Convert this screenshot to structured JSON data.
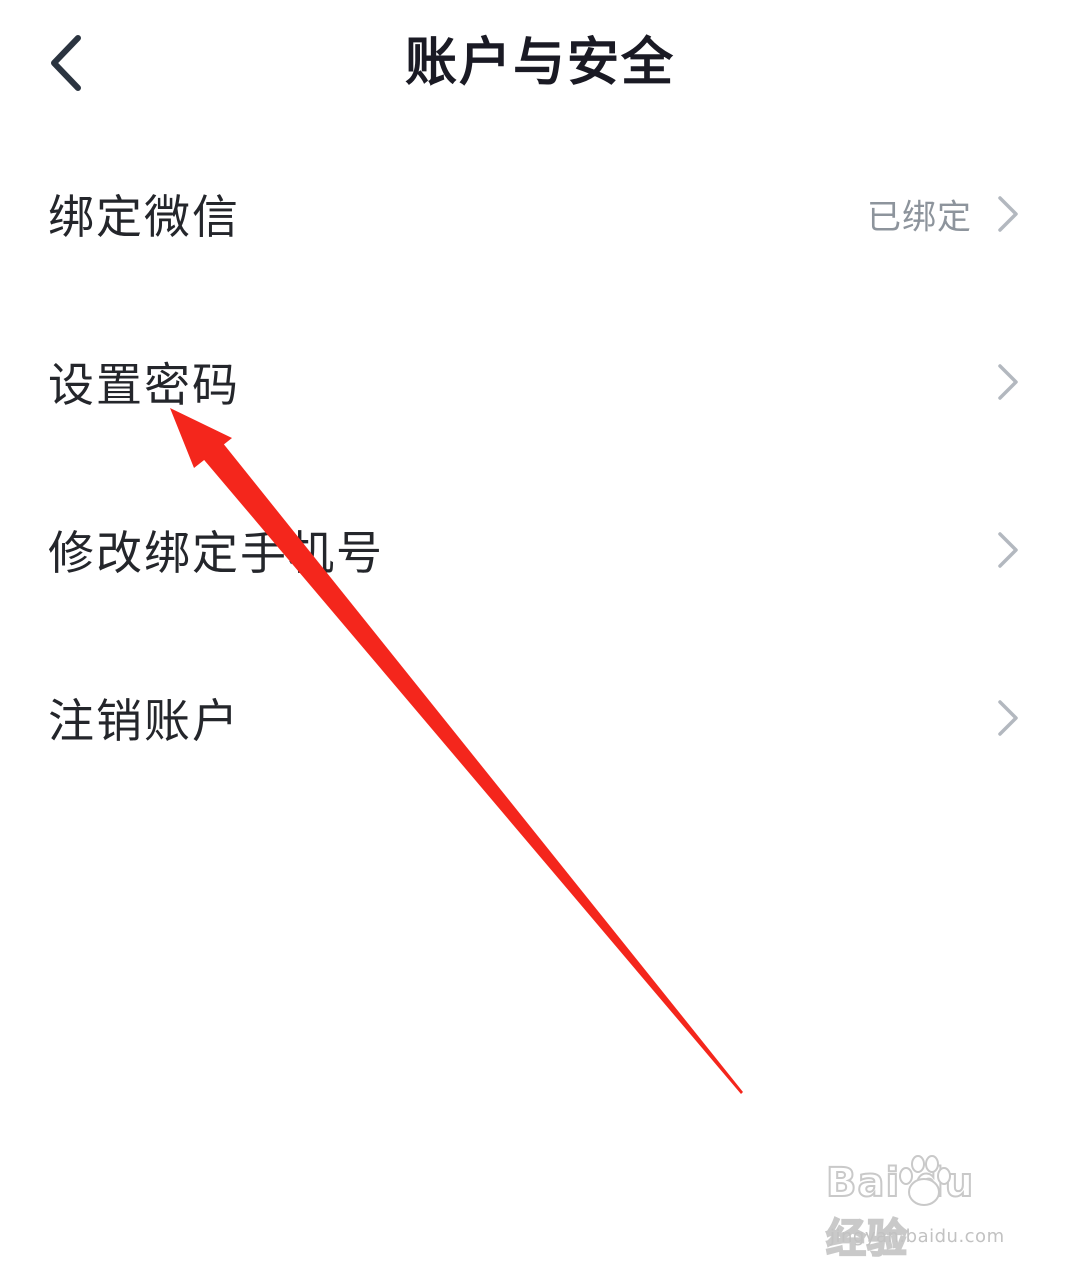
{
  "header": {
    "title": "账户与安全",
    "back_icon": "chevron-left-icon"
  },
  "menu": {
    "items": [
      {
        "label": "绑定微信",
        "value": "已绑定",
        "icon": "chevron-right-icon"
      },
      {
        "label": "设置密码",
        "value": "",
        "icon": "chevron-right-icon"
      },
      {
        "label": "修改绑定手机号",
        "value": "",
        "icon": "chevron-right-icon"
      },
      {
        "label": "注销账户",
        "value": "",
        "icon": "chevron-right-icon"
      }
    ]
  },
  "annotation": {
    "type": "arrow",
    "color": "#f4261c",
    "points_to": "设置密码"
  },
  "watermark": {
    "logo_text": "Bai du 经验",
    "url": "jingyan.baidu.com"
  },
  "colors": {
    "title": "#1a1a24",
    "label": "#24262b",
    "value": "#8d949c",
    "chevron": "#b3b8bf",
    "arrow": "#f4261c"
  }
}
